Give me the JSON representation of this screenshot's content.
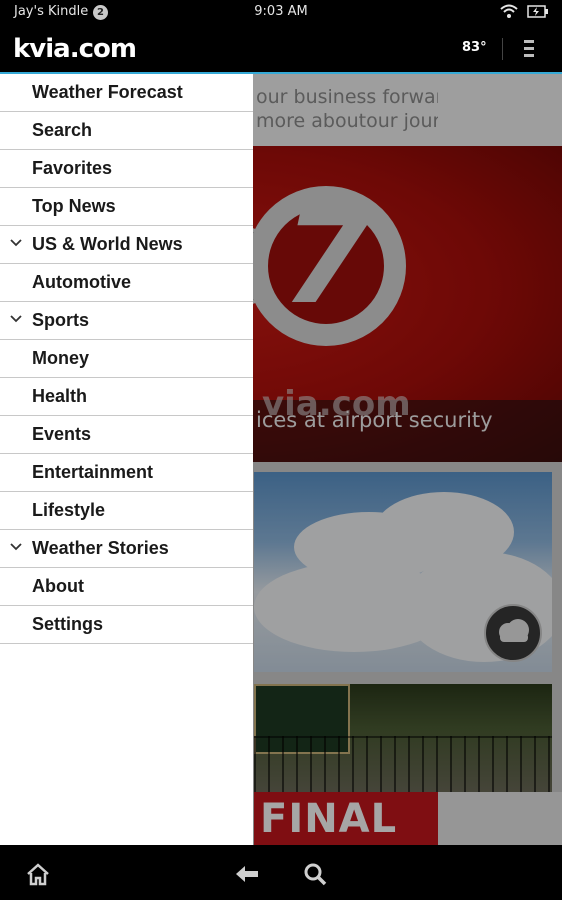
{
  "status_bar": {
    "device_name": "Jay's Kindle",
    "notification_count": "2",
    "time": "9:03 AM",
    "icons": [
      "wifi-icon",
      "battery-charging-icon"
    ]
  },
  "header": {
    "logo": "kvia.com",
    "temperature": "83°",
    "menu_icon": "overflow-menu-icon"
  },
  "drawer": {
    "items": [
      {
        "label": "Weather Forecast",
        "expandable": false
      },
      {
        "label": "Search",
        "expandable": false
      },
      {
        "label": "Favorites",
        "expandable": false
      },
      {
        "label": "Top News",
        "expandable": false
      },
      {
        "label": "US & World News",
        "expandable": true
      },
      {
        "label": "Automotive",
        "expandable": false
      },
      {
        "label": "Sports",
        "expandable": true
      },
      {
        "label": "Money",
        "expandable": false
      },
      {
        "label": "Health",
        "expandable": false
      },
      {
        "label": "Events",
        "expandable": false
      },
      {
        "label": "Entertainment",
        "expandable": false
      },
      {
        "label": "Lifestyle",
        "expandable": false
      },
      {
        "label": "Weather Stories",
        "expandable": true
      },
      {
        "label": "About",
        "expandable": false
      },
      {
        "label": "Settings",
        "expandable": false
      }
    ]
  },
  "background": {
    "ad_line_1": "our business forward.",
    "ad_line_2": "more aboutour journey",
    "hero_watermark": "via.com",
    "hero_caption": "ices at airport security",
    "sale_text": "FINAL"
  },
  "nav_bar": {
    "icons": [
      "home-icon",
      "back-icon",
      "search-icon"
    ]
  },
  "colors": {
    "accent": "#35a9d6",
    "hero_red": "#b3120d",
    "sale_red": "#c4161c"
  }
}
